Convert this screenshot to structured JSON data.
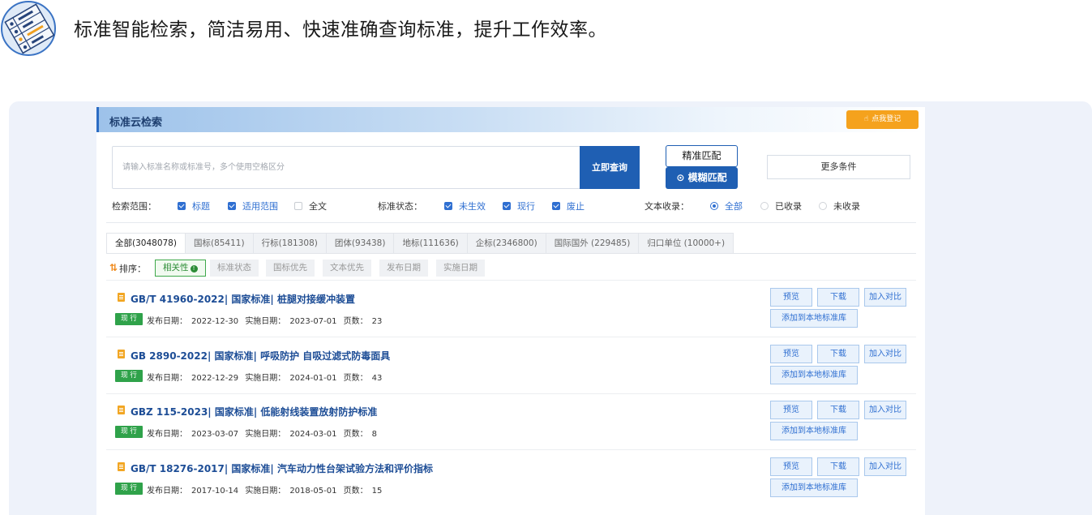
{
  "banner": {
    "tagline": "标准智能检索，简洁易用、快速准确查询标准，提升工作效率。",
    "logo_icon": "checklist-icon"
  },
  "panel": {
    "title": "标准云检索",
    "register_button": "点我登记",
    "register_icon": "cursor-icon"
  },
  "search": {
    "placeholder": "请输入标准名称或标准号，多个使用空格区分",
    "query_button": "立即查询",
    "exact_match": "精准匹配",
    "fuzzy_match": "模糊匹配",
    "more_conditions": "更多条件"
  },
  "filters": {
    "scope_label": "检索范围：",
    "scope_options": [
      {
        "label": "标题",
        "checked": true
      },
      {
        "label": "适用范围",
        "checked": true
      },
      {
        "label": "全文",
        "checked": false
      }
    ],
    "status_label": "标准状态：",
    "status_options": [
      {
        "label": "未生效",
        "checked": true
      },
      {
        "label": "现行",
        "checked": true
      },
      {
        "label": "废止",
        "checked": true
      }
    ],
    "collect_label": "文本收录：",
    "collect_options": [
      {
        "label": "全部",
        "selected": true
      },
      {
        "label": "已收录",
        "selected": false
      },
      {
        "label": "未收录",
        "selected": false
      }
    ]
  },
  "tabs": [
    "全部(3048078)",
    "国标(85411)",
    "行标(181308)",
    "团体(93438)",
    "地标(111636)",
    "企标(2346800)",
    "国际国外 (229485)",
    "归口单位 (10000+)"
  ],
  "sort": {
    "label": "排序：",
    "options": [
      "相关性",
      "标准状态",
      "国标优先",
      "文本优先",
      "发布日期",
      "实施日期"
    ],
    "active": "相关性"
  },
  "result_labels": {
    "status_badge": "现 行",
    "publish_label": "发布日期：",
    "effective_label": "实施日期：",
    "pages_label": "页数：",
    "preview": "预览",
    "download": "下载",
    "compare": "加入对比",
    "add_library": "添加到本地标准库"
  },
  "results": [
    {
      "title": "GB/T 41960-2022| 国家标准| 桩腿对接缓冲装置",
      "publish": "2022-12-30",
      "effective": "2023-07-01",
      "pages": "23"
    },
    {
      "title": "GB 2890-2022| 国家标准| 呼吸防护 自吸过滤式防毒面具",
      "publish": "2022-12-29",
      "effective": "2024-01-01",
      "pages": "43"
    },
    {
      "title": "GBZ 115-2023| 国家标准| 低能射线装置放射防护标准",
      "publish": "2023-03-07",
      "effective": "2024-03-01",
      "pages": "8"
    },
    {
      "title": "GB/T 18276-2017| 国家标准| 汽车动力性台架试验方法和评价指标",
      "publish": "2017-10-14",
      "effective": "2018-05-01",
      "pages": "15"
    }
  ],
  "colors": {
    "primary": "#1f5fb3",
    "accent_orange": "#f5a21d",
    "status_green": "#2fa24a",
    "link_blue": "#1d4d96"
  }
}
